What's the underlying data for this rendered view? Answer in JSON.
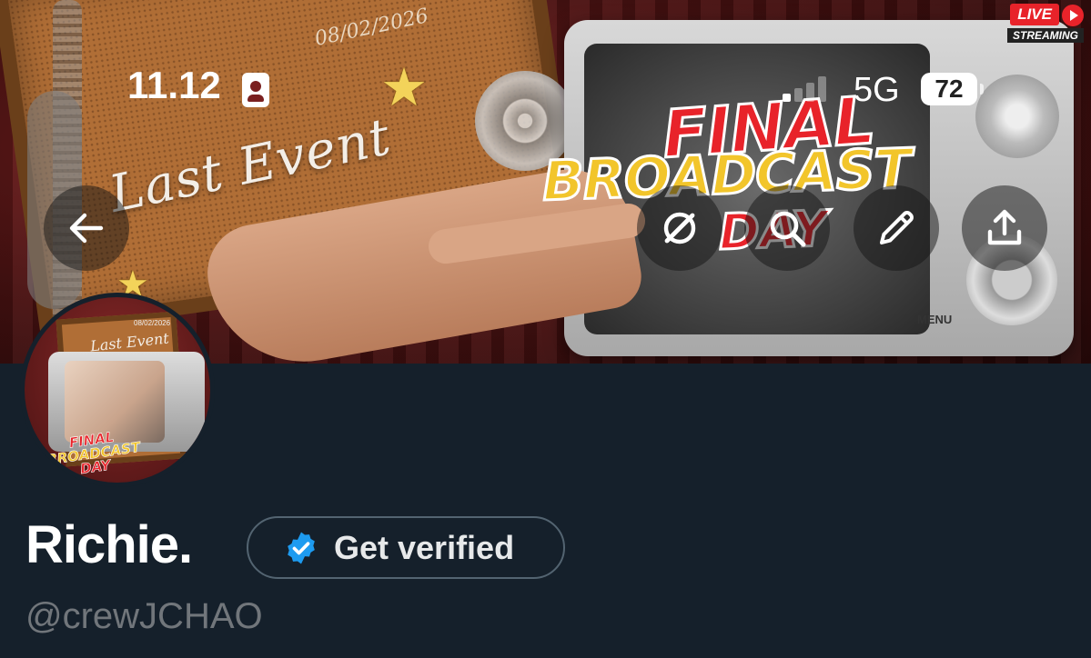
{
  "status_bar": {
    "time": "11.12",
    "network": "5G",
    "battery_level": "72"
  },
  "banner": {
    "date": "08/02/2026",
    "title": "Last Event",
    "headline": [
      "FINAL",
      "BROADCAST",
      "DAY"
    ],
    "live_badge": "LIVE",
    "streaming_badge": "STREAMING",
    "camera_menu_label": "MENU"
  },
  "actions": {
    "back_icon": "arrow-left-icon",
    "grok_icon": "grok-icon",
    "search_icon": "search-icon",
    "edit_icon": "pencil-icon",
    "share_icon": "share-icon"
  },
  "avatar": {
    "title": "Last Event",
    "date": "08/02/2026",
    "headline": [
      "FINAL",
      "BROADCAST",
      "DAY"
    ]
  },
  "profile": {
    "name": "Richie.",
    "handle": "@crewJCHAO",
    "verify_label": "Get verified"
  },
  "colors": {
    "background": "#15202b",
    "verified_blue": "#1d9bf0",
    "handle_gray": "#71767b",
    "pill_border": "#536471"
  }
}
